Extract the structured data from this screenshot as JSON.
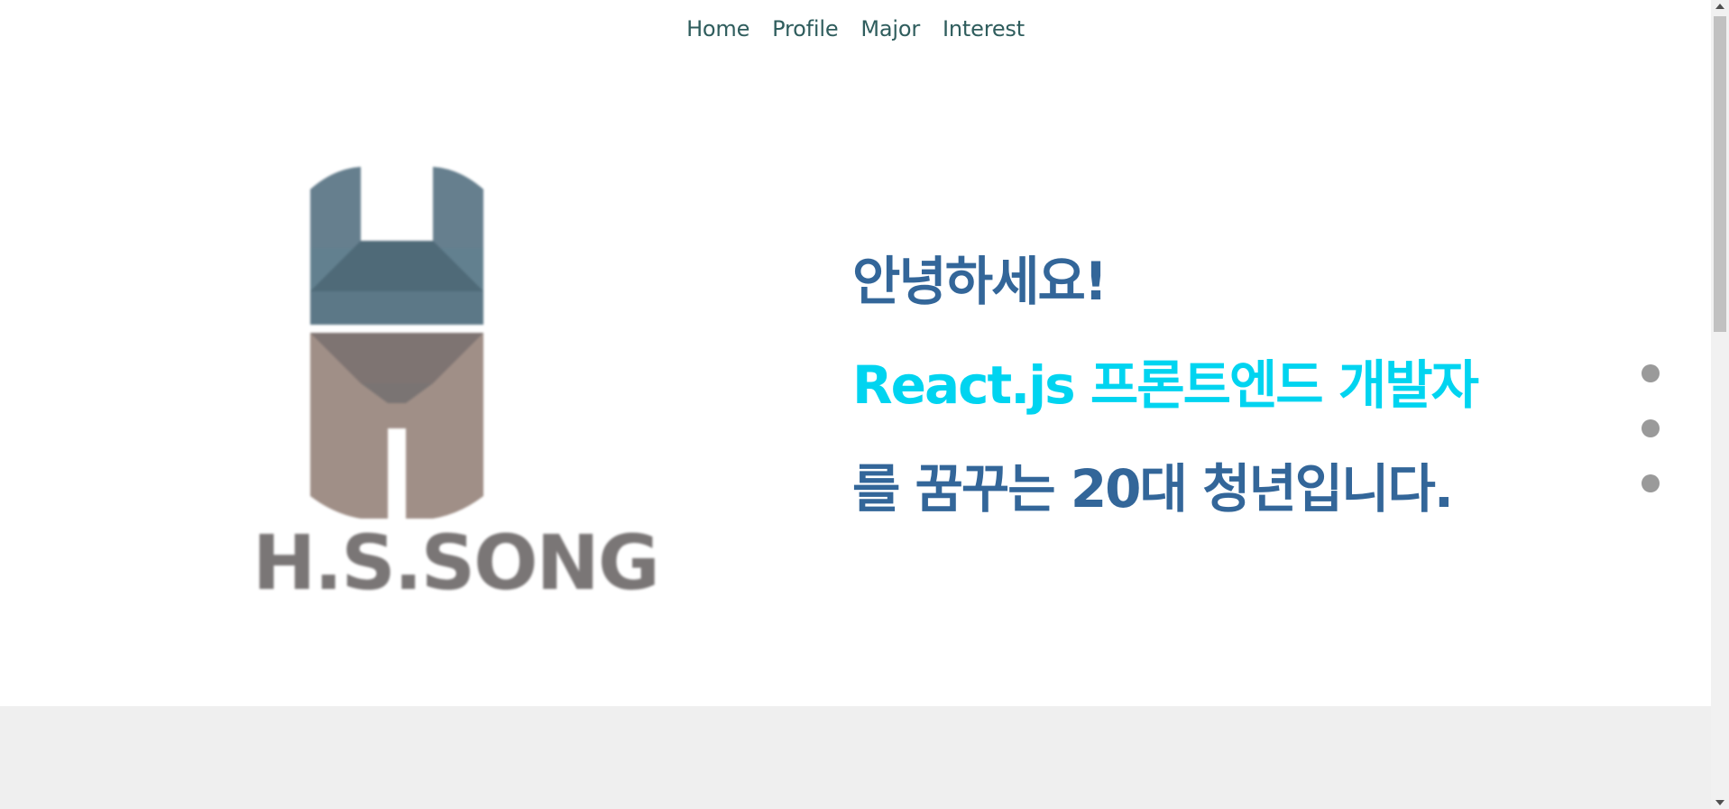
{
  "nav": {
    "items": [
      {
        "label": "Home"
      },
      {
        "label": "Profile"
      },
      {
        "label": "Major"
      },
      {
        "label": "Interest"
      }
    ]
  },
  "logo": {
    "text": "H.S.SONG",
    "colors": {
      "upper": "#62808f",
      "upper_dark": "#4d6876",
      "lower": "#a08f87",
      "lower_dark": "#7a7473",
      "text": "#7a7676"
    }
  },
  "hero": {
    "greeting": "안녕하세요!",
    "role": "React.js 프론트엔드 개발자",
    "dream": "를 꿈꾸는 20대 청년입니다."
  },
  "section_dots": {
    "count": 3
  },
  "colors": {
    "nav_text": "#2f5d5d",
    "hero_primary": "#336699",
    "hero_accent": "#00d4f0",
    "dot": "#9a9a9a",
    "next_section_bg": "#efefef"
  }
}
